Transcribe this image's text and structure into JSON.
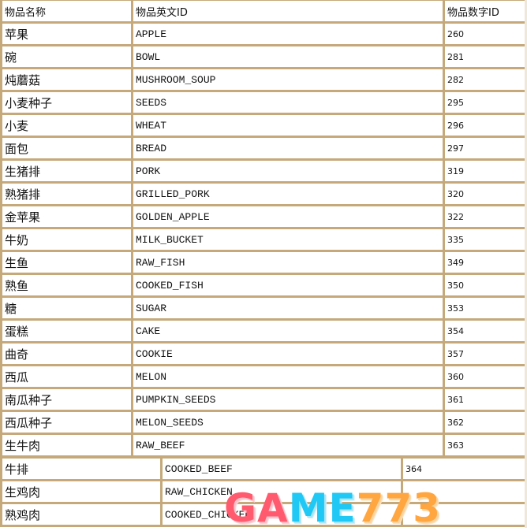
{
  "table_main": {
    "headers": [
      "物品名称",
      "物品英文ID",
      "物品数字ID"
    ],
    "rows": [
      [
        "苹果",
        "APPLE",
        "260"
      ],
      [
        "碗",
        "BOWL",
        "281"
      ],
      [
        "炖蘑菇",
        "MUSHROOM_SOUP",
        "282"
      ],
      [
        "小麦种子",
        "SEEDS",
        "295"
      ],
      [
        "小麦",
        "WHEAT",
        "296"
      ],
      [
        "面包",
        "BREAD",
        "297"
      ],
      [
        "生猪排",
        "PORK",
        "319"
      ],
      [
        "熟猪排",
        "GRILLED_PORK",
        "320"
      ],
      [
        "金苹果",
        "GOLDEN_APPLE",
        "322"
      ],
      [
        "牛奶",
        "MILK_BUCKET",
        "335"
      ],
      [
        "生鱼",
        "RAW_FISH",
        "349"
      ],
      [
        "熟鱼",
        "COOKED_FISH",
        "350"
      ],
      [
        "糖",
        "SUGAR",
        "353"
      ],
      [
        "蛋糕",
        "CAKE",
        "354"
      ],
      [
        "曲奇",
        "COOKIE",
        "357"
      ],
      [
        "西瓜",
        "MELON",
        "360"
      ],
      [
        "南瓜种子",
        "PUMPKIN_SEEDS",
        "361"
      ],
      [
        "西瓜种子",
        "MELON_SEEDS",
        "362"
      ],
      [
        "生牛肉",
        "RAW_BEEF",
        "363"
      ]
    ]
  },
  "table_continued": {
    "rows": [
      [
        "牛排",
        "COOKED_BEEF",
        "364"
      ],
      [
        "生鸡肉",
        "RAW_CHICKEN",
        ""
      ],
      [
        "熟鸡肉",
        "COOKED_CHICKEN",
        ""
      ]
    ]
  },
  "watermark": {
    "part1": "GA",
    "part2": "ME",
    "part3": "773",
    "colors": {
      "red": "#ff5a6e",
      "blue": "#1fc8f5",
      "orange": "#ffa640"
    }
  },
  "border_color": "#c5a97b"
}
